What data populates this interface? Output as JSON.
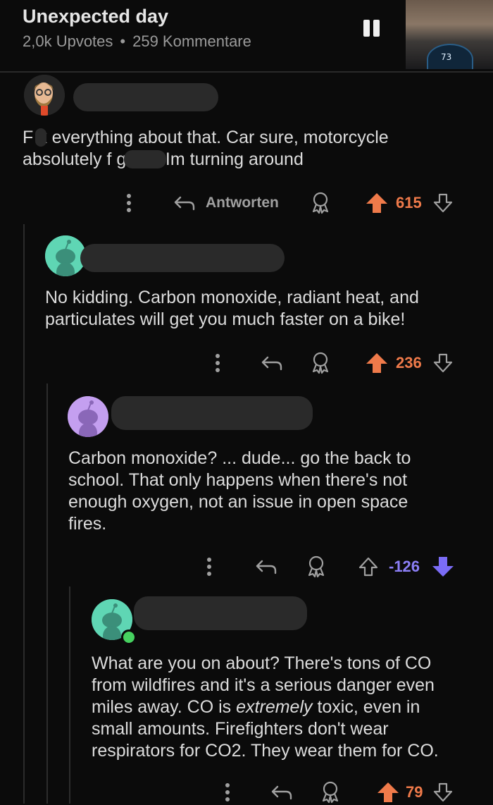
{
  "header": {
    "title": "Unexpected day",
    "upvotes": "2,0k Upvotes",
    "separator": "•",
    "comments": "259 Kommentare",
    "video_speed": "73"
  },
  "comments": [
    {
      "text_lines": [
        "F  k everything about that. Car sure, motorcycle",
        "absolutely f          g not. Im turning around"
      ],
      "reply_label": "Antworten",
      "score": "615",
      "vote_state": "up",
      "avatar_color": "#2b2b2b"
    },
    {
      "text_lines": [
        "No kidding. Carbon monoxide, radiant heat, and",
        "particulates will get you much faster on a bike!"
      ],
      "score": "236",
      "vote_state": "up",
      "avatar_color": "#5fd6b4"
    },
    {
      "text_lines": [
        "Carbon monoxide? ... dude... go the back to",
        "school. That only happens when there's not",
        "enough oxygen, not an issue in open space",
        "fires."
      ],
      "score": "-126",
      "vote_state": "down",
      "avatar_color": "#c49ff0"
    },
    {
      "text_lines": [
        "What are you on about? There's tons of CO",
        "from wildfires and it's a serious danger even",
        "miles away. CO is ",
        "extremely",
        " toxic, even in",
        "small amounts. Firefighters don't wear",
        "respirators for CO2. They wear them for CO."
      ],
      "score": "79",
      "vote_state": "up",
      "avatar_color": "#5fd6b4"
    }
  ],
  "colors": {
    "upvote": "#ef7a4a",
    "downvote": "#7b6cf6",
    "background": "#0b0b0b"
  }
}
